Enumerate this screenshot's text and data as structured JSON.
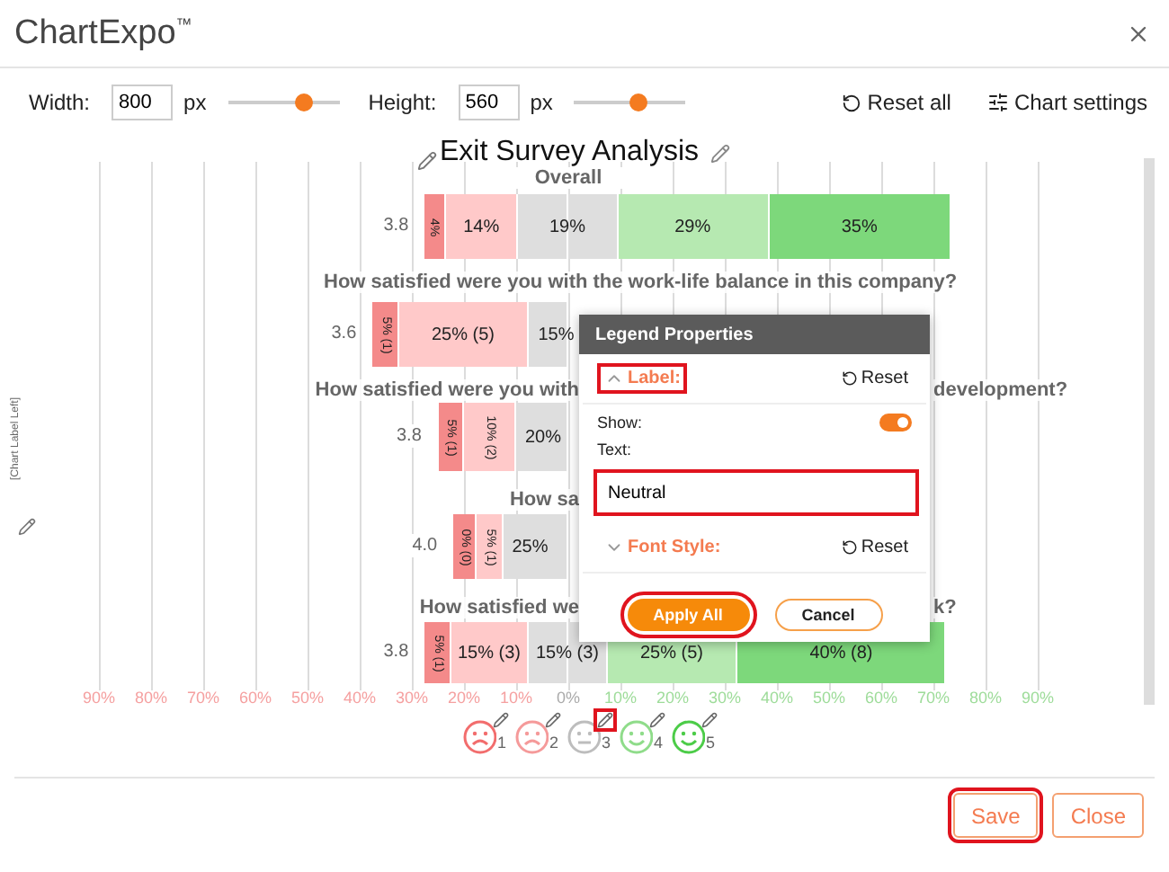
{
  "window": {
    "title": "ChartExpo$^{™}$"
  },
  "toolbar": {
    "width": {
      "label": "Width:",
      "value": "800",
      "unit": "px",
      "level": 0.68
    },
    "height": {
      "label": "Height:",
      "value": "560",
      "unit": "px",
      "level": 0.57
    },
    "reset_all": "Reset all",
    "chart_settings": "Chart settings"
  },
  "chart": {
    "title": "Exit Survey Analysis",
    "left_label": "[Chart Label Left]",
    "rows": [
      {
        "kind": "overall",
        "question": "Overall",
        "score": "3.8",
        "segments": [
          {
            "label": "4%",
            "rotated": true
          },
          {
            "label": "14%"
          },
          {
            "label": "19%"
          },
          {
            "label": "29%"
          },
          {
            "label": "35%"
          }
        ]
      },
      {
        "kind": "question",
        "question": "How satisfied were you with the work-life balance in this company?",
        "score": "3.6",
        "segments": [
          {
            "label": "5% (1)",
            "rotated": true
          },
          {
            "label": "25% (5)"
          },
          {
            "label": "15%",
            "clipped": true
          }
        ]
      },
      {
        "kind": "clipped",
        "question": "How satisfied were you with",
        "tail": "development?",
        "score": "3.8",
        "segments": [
          {
            "label": "5% (1)",
            "rotated": true
          },
          {
            "label": "10% (2)",
            "rotated": true
          },
          {
            "label": "20%",
            "clipped": true
          }
        ]
      },
      {
        "kind": "clipped",
        "question": "How sa",
        "score": "4.0",
        "segments": [
          {
            "label": "0% (0)",
            "rotated": true
          },
          {
            "label": "5% (1)",
            "rotated": true
          },
          {
            "label": "25%",
            "clipped": true
          }
        ]
      },
      {
        "kind": "clipped",
        "question": "How satisfied we",
        "tail": "k?",
        "score": "3.8",
        "segments": [
          {
            "label": "5% (1)",
            "rotated": true
          },
          {
            "label": "15% (3)"
          },
          {
            "label": "15% (3)"
          },
          {
            "label": "25% (5)"
          },
          {
            "label": "40% (8)"
          }
        ]
      }
    ],
    "chart_data": {
      "type": "bar",
      "orientation": "horizontal",
      "stacked": true,
      "grid": true,
      "categories": [
        null,
        null,
        null,
        null,
        null
      ],
      "xlim": [
        -90,
        90
      ],
      "xticks": [
        {
          "value": -90,
          "label": "90%"
        },
        {
          "value": -80,
          "label": "80%"
        },
        {
          "value": -70,
          "label": "70%"
        },
        {
          "value": -60,
          "label": "60%"
        },
        {
          "value": -50,
          "label": "50%"
        },
        {
          "value": -40,
          "label": "40%"
        },
        {
          "value": -30,
          "label": "30%"
        },
        {
          "value": -20,
          "label": "20%"
        },
        {
          "value": -10,
          "label": "10%"
        },
        {
          "value": 0,
          "label": "0%"
        },
        {
          "value": 10,
          "label": "10%"
        },
        {
          "value": 20,
          "label": "20%"
        },
        {
          "value": 30,
          "label": "30%"
        },
        {
          "value": 40,
          "label": "40%"
        },
        {
          "value": 50,
          "label": "50%"
        },
        {
          "value": 60,
          "label": "60%"
        },
        {
          "value": 70,
          "label": "70%"
        },
        {
          "value": 80,
          "label": "80%"
        },
        {
          "value": 90,
          "label": "90%"
        }
      ],
      "series": [
        {
          "color": "#dedede",
          "values": [
            -9.5,
            -7.5,
            -10,
            -12.5,
            -7.5
          ]
        },
        {
          "color": "#ffc9c9",
          "values": [
            -14,
            -25,
            -10,
            -5,
            -15
          ]
        },
        {
          "color": "#f48a8a",
          "values": [
            -4,
            -5,
            -5,
            0,
            -5
          ]
        },
        {
          "color": "#dedede",
          "values": [
            9.5,
            null,
            null,
            null,
            7.5
          ]
        },
        {
          "color": "#b6e9b1",
          "values": [
            29,
            null,
            null,
            null,
            25
          ]
        },
        {
          "color": "#7dd87b",
          "values": [
            35,
            null,
            null,
            null,
            40
          ]
        }
      ]
    },
    "legend": [
      {
        "label": "1",
        "kind": "sad",
        "color": "#f26d6d",
        "highlighted": false
      },
      {
        "label": "2",
        "kind": "sad",
        "color": "#f59a9a",
        "highlighted": false
      },
      {
        "label": "3",
        "kind": "neutral",
        "color": "#bdbdbd",
        "highlighted": true
      },
      {
        "label": "4",
        "kind": "happy",
        "color": "#8fdc8a",
        "highlighted": false
      },
      {
        "label": "5",
        "kind": "happy",
        "color": "#4ccc48",
        "highlighted": false
      }
    ]
  },
  "popup": {
    "title": "Legend Properties",
    "label_section": {
      "title": "Label:",
      "expanded": true,
      "highlighted": true,
      "reset": "Reset"
    },
    "show": {
      "label": "Show:",
      "on": true
    },
    "text": {
      "label": "Text:",
      "value": "Neutral",
      "highlighted": true
    },
    "font_section": {
      "title": "Font Style:",
      "expanded": false,
      "reset": "Reset"
    },
    "apply": {
      "label": "Apply All",
      "highlighted": true
    },
    "cancel": "Cancel"
  },
  "footer": {
    "save": {
      "label": "Save",
      "highlighted": true
    },
    "close": {
      "label": "Close",
      "highlighted": false
    }
  }
}
